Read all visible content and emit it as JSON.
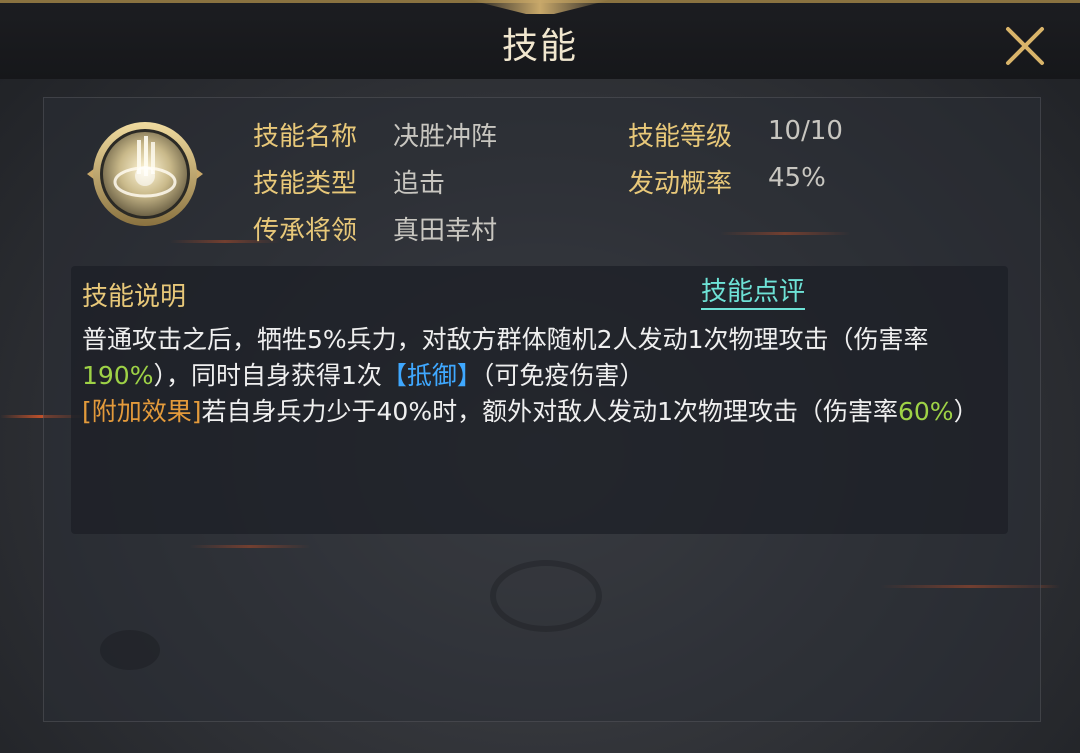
{
  "header": {
    "title": "技能"
  },
  "skill": {
    "name_label": "技能名称",
    "name_value": "决胜冲阵",
    "type_label": "技能类型",
    "type_value": "追击",
    "inherit_label": "传承将领",
    "inherit_value": "真田幸村",
    "level_label": "技能等级",
    "level_value": "10/10",
    "chance_label": "发动概率",
    "chance_value": "45%"
  },
  "description": {
    "title": "技能说明",
    "review_link": "技能点评",
    "seg1": "普通攻击之后，牺牲5%兵力，对敌方群体随机2人发动1次物理攻击（伤害率",
    "rate1": "190%",
    "seg2": "），同时自身获得1次",
    "status": "【抵御】",
    "seg3": "（可免疫伤害）",
    "extra_tag": "[附加效果]",
    "seg4": "若自身兵力少于40%时，额外对敌人发动1次物理攻击（伤害率",
    "rate2": "60%",
    "seg5": "）"
  },
  "colors": {
    "gold": "#e8c879",
    "cyan": "#6ee2d6",
    "green": "#9ed246",
    "blue": "#3fa8ff",
    "orange": "#e39a3b"
  },
  "icons": {
    "close": "close-icon",
    "skill": "skill-emblem-icon"
  }
}
